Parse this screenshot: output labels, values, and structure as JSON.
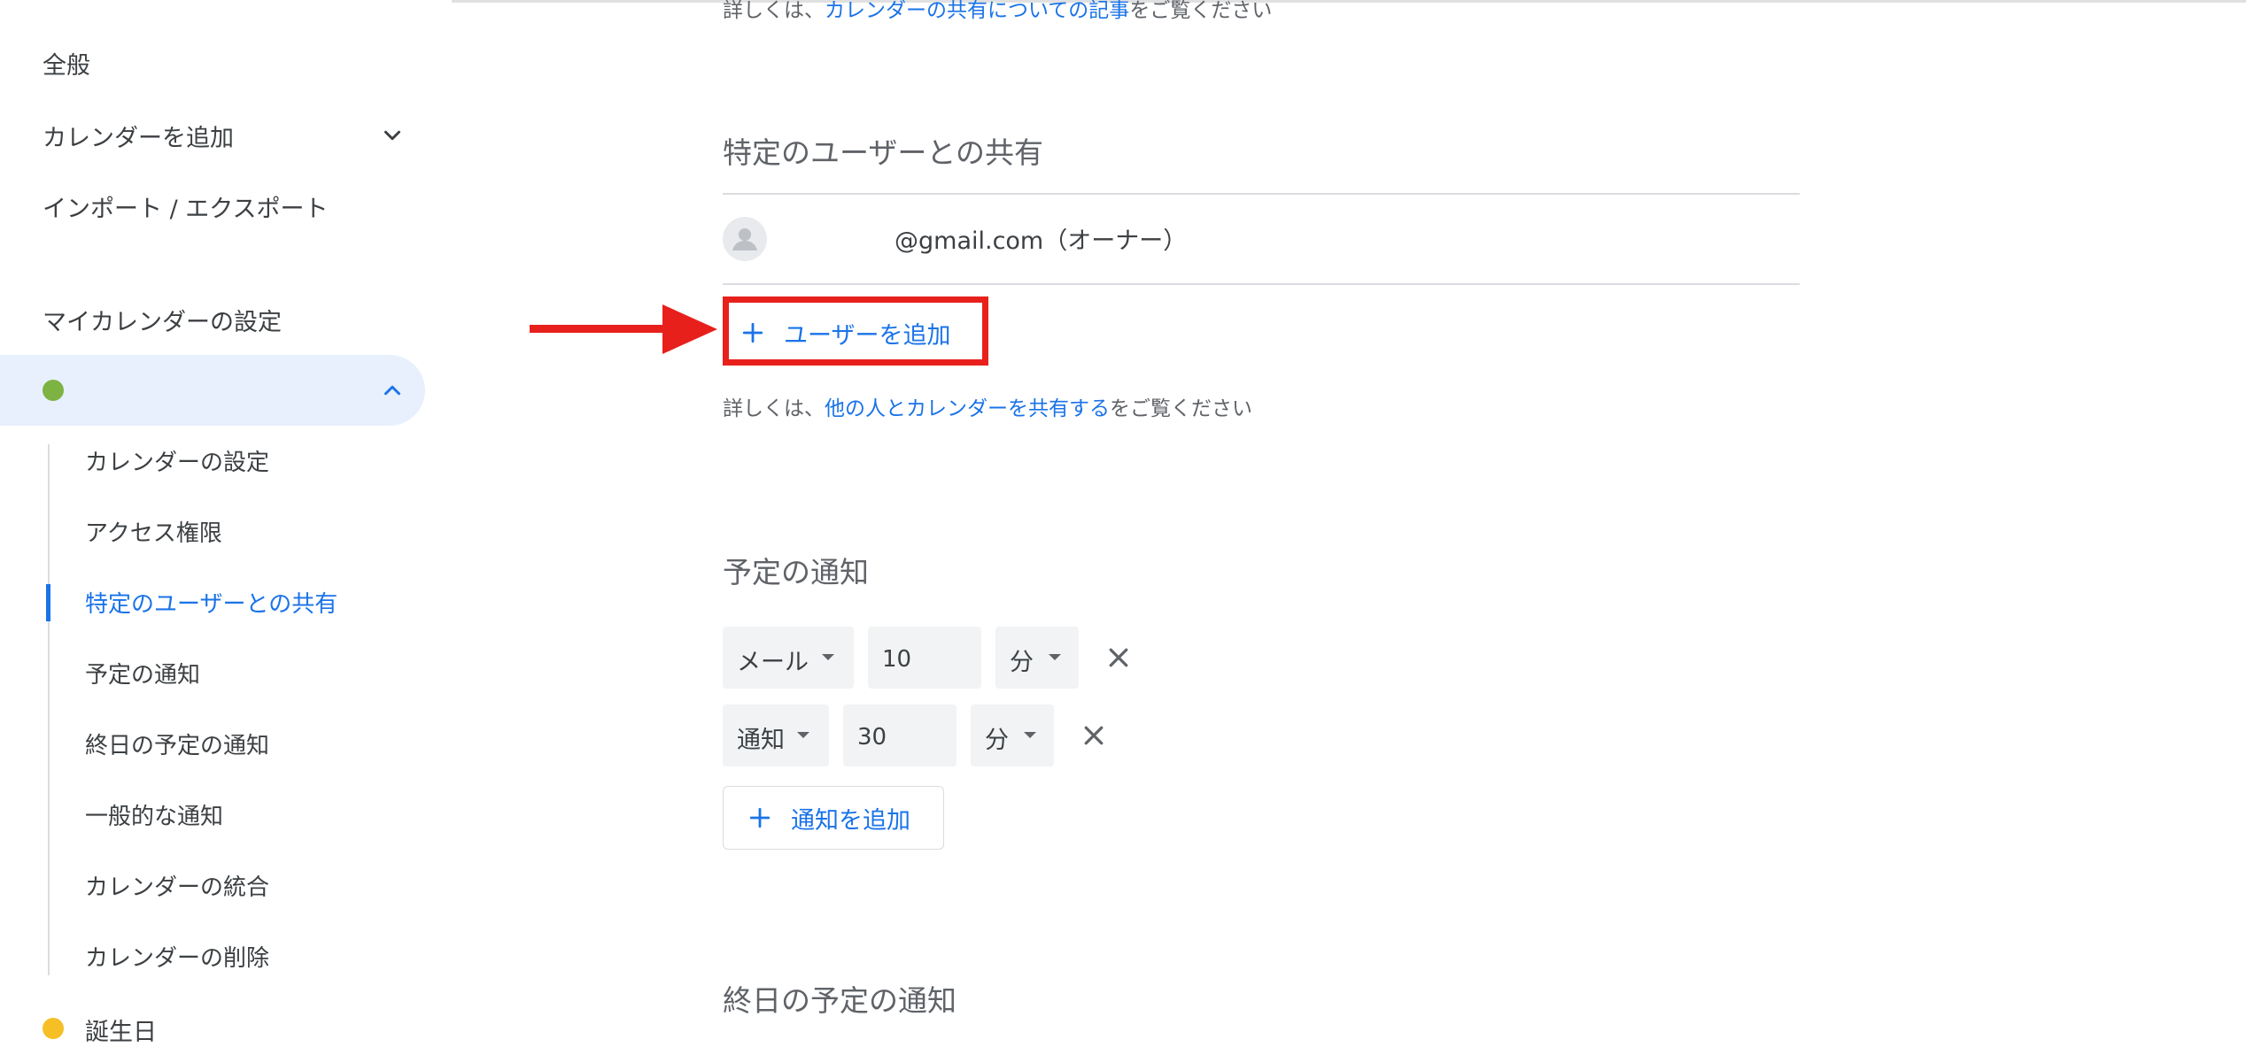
{
  "sidebar": {
    "general": "全般",
    "add_calendar": "カレンダーを追加",
    "import_export": "インポート / エクスポート",
    "my_calendar_settings": "マイカレンダーの設定",
    "selected_calendar_color": "#7cb342",
    "sub_items": [
      "カレンダーの設定",
      "アクセス権限",
      "特定のユーザーとの共有",
      "予定の通知",
      "終日の予定の通知",
      "一般的な通知",
      "カレンダーの統合",
      "カレンダーの削除"
    ],
    "active_sub_item_index": 2,
    "birthday": {
      "label": "誕生日",
      "color": "#f6bf26"
    }
  },
  "main": {
    "top_help": {
      "prefix": "詳しくは、",
      "link": "カレンダーの共有についての記事",
      "suffix": "をご覧ください"
    },
    "sharing": {
      "heading": "特定のユーザーとの共有",
      "owner_email": "@gmail.com（オーナー）",
      "add_user_label": "ユーザーを追加",
      "help_prefix": "詳しくは、",
      "help_link": "他の人とカレンダーを共有する",
      "help_suffix": "をご覧ください"
    },
    "notifications": {
      "heading": "予定の通知",
      "rows": [
        {
          "method": "メール",
          "value": "10",
          "unit": "分"
        },
        {
          "method": "通知",
          "value": "30",
          "unit": "分"
        }
      ],
      "add_label": "通知を追加"
    },
    "all_day_heading": "終日の予定の通知"
  },
  "annotation": {
    "highlight_color": "#e8201c"
  },
  "icons": {
    "add_calendar_chevron": "chevron-down-icon",
    "selected_calendar_chevron": "chevron-up-icon",
    "avatar": "person-icon",
    "plus": "plus-icon",
    "remove": "close-icon"
  }
}
